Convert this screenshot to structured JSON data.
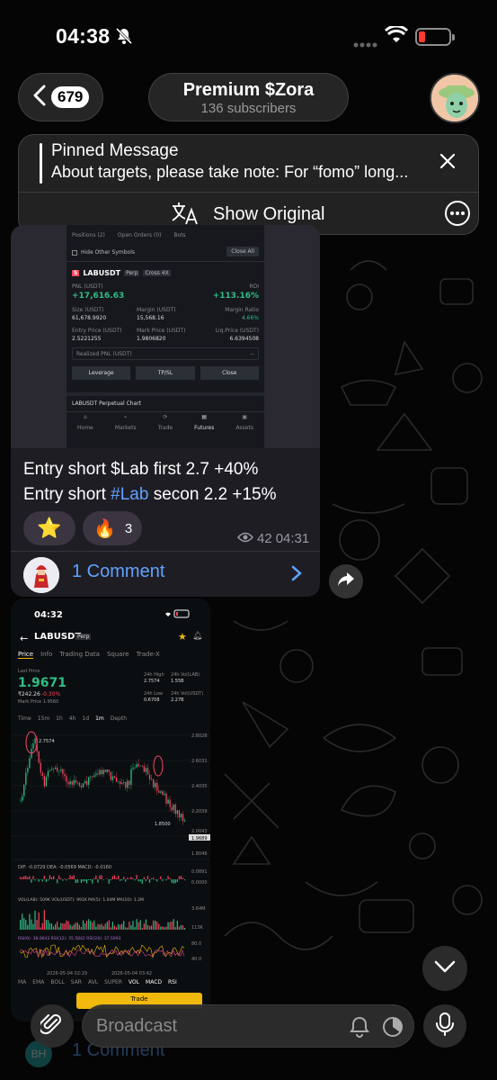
{
  "status_bar": {
    "time": "04:38"
  },
  "header": {
    "back_count": "679",
    "title": "Premium $Zora",
    "subtitle": "136 subscribers"
  },
  "pinned": {
    "label": "Pinned Message",
    "text": "About targets, please take note: For “fomo” long...",
    "show_original": "Show Original"
  },
  "message1": {
    "shot": {
      "tabs": [
        "Positions (2)",
        "Open Orders (0)",
        "Bots"
      ],
      "hide_other": "Hide Other Symbols",
      "close_all": "Close All",
      "symbol": "LABUSDT",
      "perp": "Perp",
      "cross": "Cross 4X",
      "pnl_label": "PNL (USDT)",
      "pnl_value": "+17,616.63",
      "roi_label": "ROI",
      "roi_value": "+113.16%",
      "size_label": "Size (USDT)",
      "size_value": "61,678.9920",
      "margin_label": "Margin (USDT)",
      "margin_value": "15,568.16",
      "ratio_label": "Margin Ratio",
      "ratio_value": "4.66%",
      "entry_label": "Entry Price (USDT)",
      "entry_value": "2.5221255",
      "mark_label": "Mark Price (USDT)",
      "mark_value": "1.9806820",
      "liq_label": "Liq.Price (USDT)",
      "liq_value": "6.6394508",
      "realized": "Realized PNL (USDT)",
      "realized_value": "--",
      "btn_leverage": "Leverage",
      "btn_tpsl": "TP/SL",
      "btn_close": "Close",
      "chart_title": "LABUSDT Perpetual Chart",
      "nav": [
        "Home",
        "Markets",
        "Trade",
        "Futures",
        "Assets"
      ]
    },
    "line1": "Entry short $Lab first 2.7 +40%",
    "line2_prefix": "Entry short ",
    "line2_tag": "#Lab",
    "line2_suffix": " secon 2.2 +15%",
    "reaction_star": "⭐",
    "reaction_fire": "🔥",
    "reaction_fire_count": "3",
    "views": "42",
    "time": "04:31",
    "comments": "1 Comment"
  },
  "message2": {
    "time": "04:32",
    "symbol": "LABUSDT",
    "perp": "Perp",
    "tabs": [
      "Price",
      "Info",
      "Trading Data",
      "Square",
      "Trade-X"
    ],
    "last_price_label": "Last Price",
    "last_price": "1.9671",
    "price_change": "₹242.26",
    "pct_change": "-0.30%",
    "mark_price": "Mark Price 1.9560",
    "high_label": "24h High",
    "high": "2.7574",
    "vol_lab_label": "24h Vol(LAB)",
    "vol_lab": "1.55B",
    "low_label": "24h Low",
    "low": "0.6708",
    "vol_usdt_label": "24h Vol(USDT)",
    "vol_usdt": "2.27B",
    "intervals": [
      "Time",
      "15m",
      "1h",
      "4h",
      "1d",
      "1m",
      "Depth"
    ],
    "chart_high": "2.7574",
    "chart_low": "1.8500",
    "axis": [
      "2.8028",
      "2.6031",
      "2.4035",
      "2.2039",
      "2.0043",
      "1.9689",
      "1.8046"
    ],
    "macd": "DIF: -0.0729  DEA: -0.0569  MACD: -0.0160",
    "macd_axis": [
      "0.0891",
      "0.0000"
    ],
    "vol": "VOL(LAB): 509K  VOL(USDT): 991K  MA(5): 1.04M  MA(10): 1.2M",
    "vol_axis": [
      "3.64M",
      "113K"
    ],
    "rsi": "RSI(6): 38.0643  RSI(12): 35.5842  RSI(24): 37.5093",
    "rsi_axis": [
      "80.0",
      "40.0"
    ],
    "dates": [
      "2026-05-04 02:29",
      "2026-05-04 03:42"
    ],
    "indicators": [
      "MA",
      "EMA",
      "BOLL",
      "SAR",
      "AVL",
      "SUPER",
      "VOL",
      "MACD",
      "RSI"
    ],
    "trade_btn": "Trade"
  },
  "composer": {
    "placeholder": "Broadcast"
  },
  "below": {
    "avatar_initials": "BH",
    "comments": "1 Comment"
  },
  "colors": {
    "accent": "#5fa3ff",
    "green": "#2ebd85",
    "red": "#f6465d",
    "bubble": "#1f1d24"
  }
}
